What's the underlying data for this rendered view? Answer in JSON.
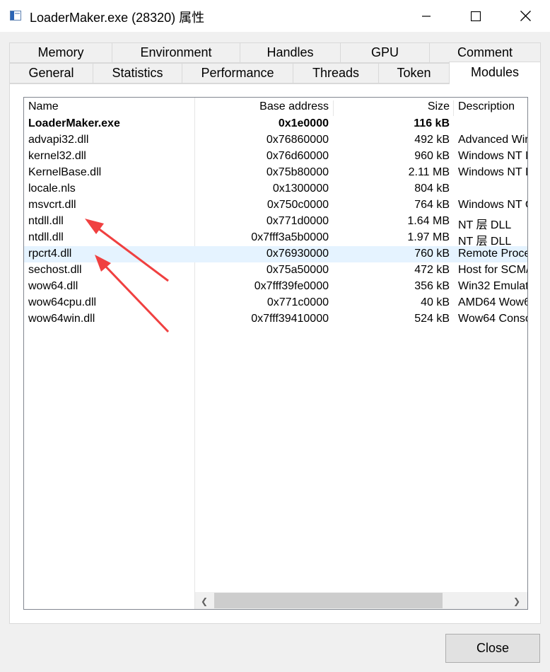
{
  "window": {
    "title": "LoaderMaker.exe (28320) 属性"
  },
  "tabs_row1": [
    "Memory",
    "Environment",
    "Handles",
    "GPU",
    "Comment"
  ],
  "tabs_row2": [
    "General",
    "Statistics",
    "Performance",
    "Threads",
    "Token",
    "Modules"
  ],
  "active_tab": "Modules",
  "columns": [
    "Name",
    "Base address",
    "Size",
    "Description"
  ],
  "modules": [
    {
      "name": "LoaderMaker.exe",
      "base": "0x1e0000",
      "size": "116 kB",
      "desc": ""
    },
    {
      "name": "advapi32.dll",
      "base": "0x76860000",
      "size": "492 kB",
      "desc": "Advanced Wir"
    },
    {
      "name": "kernel32.dll",
      "base": "0x76d60000",
      "size": "960 kB",
      "desc": "Windows NT I"
    },
    {
      "name": "KernelBase.dll",
      "base": "0x75b80000",
      "size": "2.11 MB",
      "desc": "Windows NT I"
    },
    {
      "name": "locale.nls",
      "base": "0x1300000",
      "size": "804 kB",
      "desc": ""
    },
    {
      "name": "msvcrt.dll",
      "base": "0x750c0000",
      "size": "764 kB",
      "desc": "Windows NT C"
    },
    {
      "name": "ntdll.dll",
      "base": "0x771d0000",
      "size": "1.64 MB",
      "desc": "NT 层 DLL"
    },
    {
      "name": "ntdll.dll",
      "base": "0x7fff3a5b0000",
      "size": "1.97 MB",
      "desc": "NT 层 DLL"
    },
    {
      "name": "rpcrt4.dll",
      "base": "0x76930000",
      "size": "760 kB",
      "desc": "Remote Proce"
    },
    {
      "name": "sechost.dll",
      "base": "0x75a50000",
      "size": "472 kB",
      "desc": "Host for SCM/"
    },
    {
      "name": "wow64.dll",
      "base": "0x7fff39fe0000",
      "size": "356 kB",
      "desc": "Win32 Emulat"
    },
    {
      "name": "wow64cpu.dll",
      "base": "0x771c0000",
      "size": "40 kB",
      "desc": "AMD64 Wow6"
    },
    {
      "name": "wow64win.dll",
      "base": "0x7fff39410000",
      "size": "524 kB",
      "desc": "Wow64 Conso"
    }
  ],
  "selected_index": 8,
  "buttons": {
    "close": "Close"
  },
  "colors": {
    "annotation_arrow": "#f04040",
    "selection": "#e5f3ff"
  }
}
